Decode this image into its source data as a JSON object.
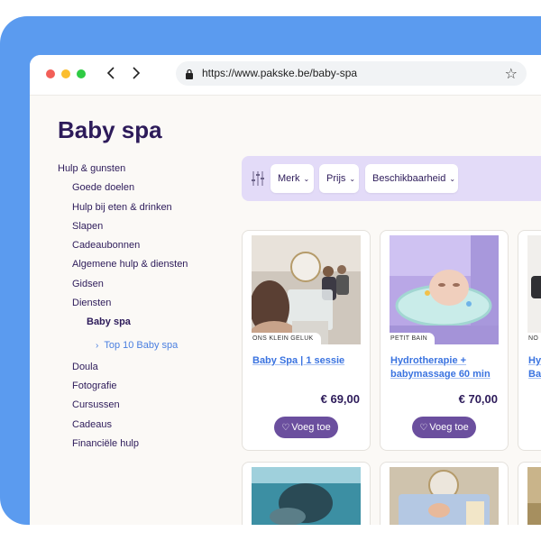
{
  "browser": {
    "url": "https://www.pakske.be/baby-spa",
    "back_icon": "chevron-left-icon",
    "forward_icon": "chevron-right-icon",
    "lock_icon": "lock-icon",
    "bookmark_icon": "star-icon"
  },
  "page": {
    "title": "Baby spa"
  },
  "sidebar": {
    "items": [
      {
        "label": "Hulp & gunsten",
        "level": 0
      },
      {
        "label": "Goede doelen",
        "level": 1
      },
      {
        "label": "Hulp bij eten & drinken",
        "level": 1
      },
      {
        "label": "Slapen",
        "level": 1
      },
      {
        "label": "Cadeaubonnen",
        "level": 1
      },
      {
        "label": "Algemene hulp & diensten",
        "level": 1
      },
      {
        "label": "Gidsen",
        "level": 1
      },
      {
        "label": "Diensten",
        "level": 1
      },
      {
        "label": "Baby spa",
        "level": 2,
        "active": true
      },
      {
        "label": "Top 10 Baby spa",
        "level": 3
      },
      {
        "label": "Doula",
        "level": 2
      },
      {
        "label": "Fotografie",
        "level": 2
      },
      {
        "label": "Cursussen",
        "level": 1
      },
      {
        "label": "Cadeaus",
        "level": 1
      },
      {
        "label": "Financiële hulp",
        "level": 1
      }
    ]
  },
  "filters": {
    "icon": "sliders-icon",
    "merk": "Merk",
    "prijs": "Prijs",
    "beschikbaarheid": "Beschikbaarheid"
  },
  "products": [
    {
      "brand": "ONS KLEIN GELUK",
      "title": "Baby Spa | 1 sessie",
      "price": "€ 69,00",
      "button": "Voeg toe"
    },
    {
      "brand": "PETIT BAIN",
      "title": "Hydrotherapie + babymassage 60 min",
      "price": "€ 70,00",
      "button": "Voeg toe"
    },
    {
      "brand": "NO",
      "title": "Hy Ba",
      "price": "",
      "button": ""
    }
  ],
  "colors": {
    "brand_purple": "#2d1b5a",
    "accent_blue": "#3a73e0",
    "button_purple": "#6b4f9e",
    "filter_bg": "#e3dbf8",
    "frame_blue": "#5b9bef"
  }
}
